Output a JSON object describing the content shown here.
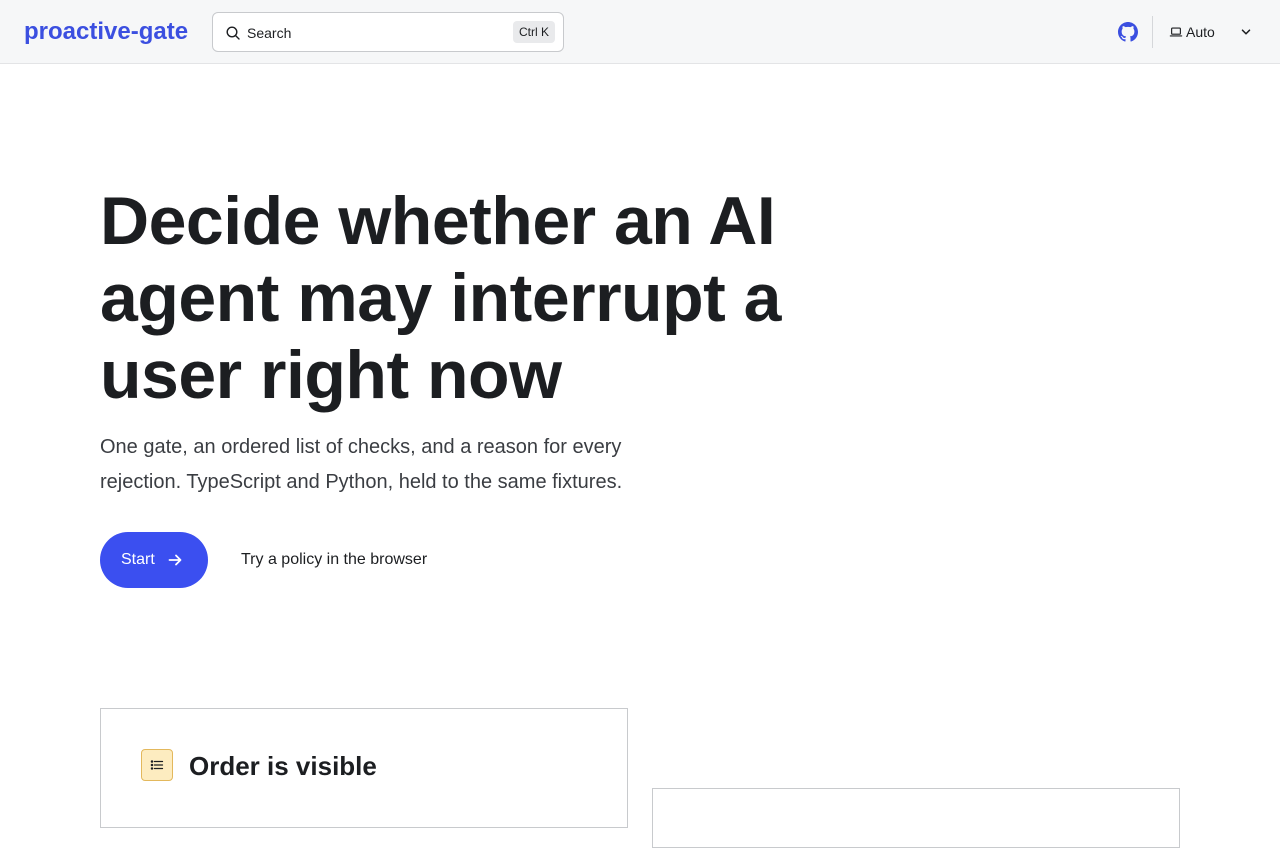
{
  "navbar": {
    "brand": "proactive-gate",
    "search": {
      "placeholder": "Search",
      "shortcut": "Ctrl K"
    },
    "github_icon": "github-icon",
    "theme": {
      "label": "Auto",
      "icon": "laptop-icon"
    }
  },
  "hero": {
    "title": "Decide whether an AI agent may interrupt a user right now",
    "subtitle": "One gate, an ordered list of checks, and a reason for every rejection. TypeScript and Python, held to the same fixtures.",
    "primary_button": "Start",
    "secondary_link": "Try a policy in the browser"
  },
  "features": [
    {
      "title": "Order is visible",
      "icon": "list-icon"
    }
  ],
  "colors": {
    "accent": "#3b4ff0",
    "brand": "#3b4fe0",
    "navbar_bg": "#f6f7f8",
    "feature_icon_bg": "#fdecc0"
  }
}
